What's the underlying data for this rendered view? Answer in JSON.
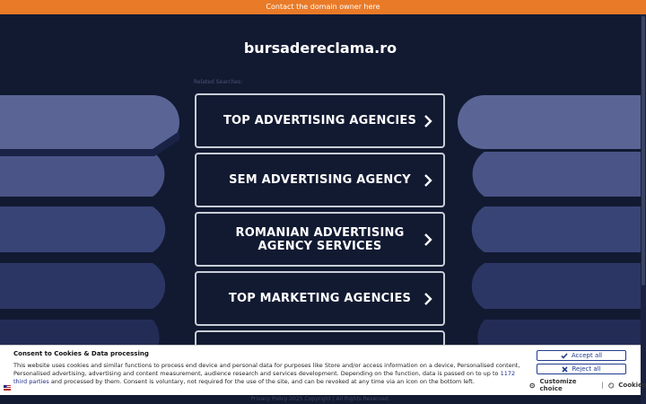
{
  "topbar": {
    "text": "Contact the domain owner here"
  },
  "site": {
    "domain": "bursadereclama.ro",
    "related_label": "Related Searches:"
  },
  "searches": [
    {
      "label": "TOP ADVERTISING AGENCIES"
    },
    {
      "label": "SEM ADVERTISING AGENCY"
    },
    {
      "label": "ROMANIAN ADVERTISING AGENCY SERVICES"
    },
    {
      "label": "TOP MARKETING AGENCIES"
    },
    {
      "label": ""
    }
  ],
  "consent": {
    "title": "Consent to Cookies & Data processing",
    "text_before_link": "This website uses cookies and similar functions to process end device and personal data for purposes like Store and/or access information on a device, Personalised content, Personalised advertising, advertising and content measurement, audience research and services development. Depending on the function, data is passed on to up to ",
    "link": "1172 third parties",
    "text_after_link": " and processed by them. Consent is voluntary, not required for the use of the site, and can be revoked at any time via an icon on the bottom left.",
    "accept_label": "Accept all",
    "reject_label": "Reject all",
    "customize_label": "Customize choice",
    "separator": "|",
    "cookies_label": "Cookies"
  },
  "footer": {
    "text": "Privacy Policy   2025 Copyright | All Rights Reserved."
  },
  "colors": {
    "topbar": "#e97a27",
    "background": "#121a32",
    "accent": "#1f3c8f"
  },
  "icons": [
    "chevron-right-icon",
    "check-icon",
    "x-icon",
    "gear-icon",
    "cookie-icon",
    "flag-icon"
  ]
}
